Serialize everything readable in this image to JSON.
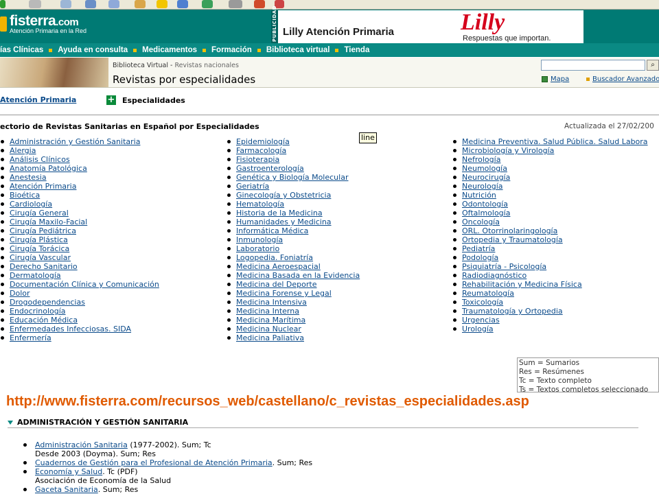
{
  "header": {
    "logo_main": "fisterra",
    "logo_dot_com": ".com",
    "logo_sub": "Atención Primaria en la Red",
    "publicidad": "PUBLICIDAD",
    "banner_text": "Lilly Atención Primaria",
    "lilly_logo": "Lilly",
    "lilly_tagline": "Respuestas que importan."
  },
  "nav": {
    "items": [
      "ías Clínicas",
      "Ayuda en consulta",
      "Medicamentos",
      "Formación",
      "Biblioteca virtual",
      "Tienda"
    ]
  },
  "breadcrumb": {
    "parent": "Biblioteca Virtual",
    "sep": " - ",
    "current": "Revistas nacionales"
  },
  "page_title": "Revistas por especialidades",
  "search": {
    "value": "",
    "button_icon": "magnifier-icon"
  },
  "links": {
    "map": "Mapa",
    "advanced": "Buscador Avanzado"
  },
  "tabs": {
    "ap": "Atención Primaria",
    "esp": "Especialidades"
  },
  "directory_title": "ectorio de Revistas Sanitarias en Español por Especialidades",
  "updated": "Actualizada el 27/02/200",
  "tooltip": "line",
  "specialties": {
    "col1": [
      "Administración y Gestión Sanitaria",
      "Alergia",
      "Análisis Clínicos",
      "Anatomía Patológica",
      "Anestesia",
      "Atención Primaria",
      "Bioética",
      "Cardiología",
      "Cirugía General",
      "Cirugía Maxilo-Facial",
      "Cirugía Pediátrica",
      "Cirugía Plástica",
      "Cirugía Torácica",
      "Cirugía Vascular",
      "Derecho Sanitario",
      "Dermatología",
      "Documentación Clínica y Comunicación",
      "Dolor",
      "Drogodependencias",
      "Endocrinología",
      "Educación Médica",
      "Enfermedades Infecciosas.  SIDA",
      "Enfermería"
    ],
    "col2": [
      "Epidemiología",
      "Farmacología",
      "Fisioterapia",
      "Gastroenterología",
      "Genética y Biología Molecular",
      "Geriatría",
      "Ginecología y Obstetricia",
      "Hematología",
      "Historia de la Medicina",
      "Humanidades y Medicina",
      "Informática Médica",
      "Inmunología",
      "Laboratorio",
      "Logopedia.  Foniatría",
      "Medicina Aeroespacial",
      "Medicina Basada en la Evidencia",
      "Medicina del Deporte",
      "Medicina Forense y Legal",
      "Medicina Intensiva",
      "Medicina Interna",
      "Medicina Marítima",
      "Medicina Nuclear",
      "Medicina Paliativa"
    ],
    "col3": [
      "Medicina Preventiva.  Salud Pública.  Salud Labora",
      "Microbiología y Virología",
      "Nefrología",
      "Neumología",
      "Neurocirugía",
      "Neurología",
      "Nutrición",
      "Odontología",
      "Oftalmología",
      "Oncología",
      "ORL.  Otorrinolaringología",
      "Ortopedia y Traumatología",
      "Pediatría",
      "Podología",
      "Psiquiatría - Psicología",
      "Radiodiagnóstico",
      "Rehabilitación y Medicina Física",
      "Reumatología",
      "Toxicología",
      "Traumatología y Ortopedia",
      "Urgencias",
      "Urología"
    ]
  },
  "legend": [
    "Sum = Sumarios",
    "Res = Resúmenes",
    "Tc = Texto completo",
    "Ts = Textos completos seleccionado"
  ],
  "url": "http://www.fisterra.com/recursos_web/castellano/c_revistas_especialidades.asp",
  "section_heading": "ADMINISTRACIÓN Y GESTIÓN SANITARIA",
  "journals": [
    {
      "name": "Administración Sanitaria",
      "rest": " (1977-2002). Sum; Tc",
      "line2": "Desde 2003 (Doyma). Sum; Res"
    },
    {
      "name": "Cuadernos de Gestión para el Profesional de Atención Primaria",
      "rest": ". Sum; Res",
      "line2": ""
    },
    {
      "name": "Economía y Salud",
      "rest": ". Tc (PDF)",
      "line2": "Asociación de Economía de la Salud"
    },
    {
      "name": "Gaceta Sanitaria",
      "rest": ". Sum; Res",
      "line2": ""
    }
  ],
  "colors": {
    "header": "#007a74",
    "nav": "#0a8a84",
    "link": "#0a4a8a",
    "url": "#e05a00",
    "bullet_accent": "#f0c000"
  }
}
